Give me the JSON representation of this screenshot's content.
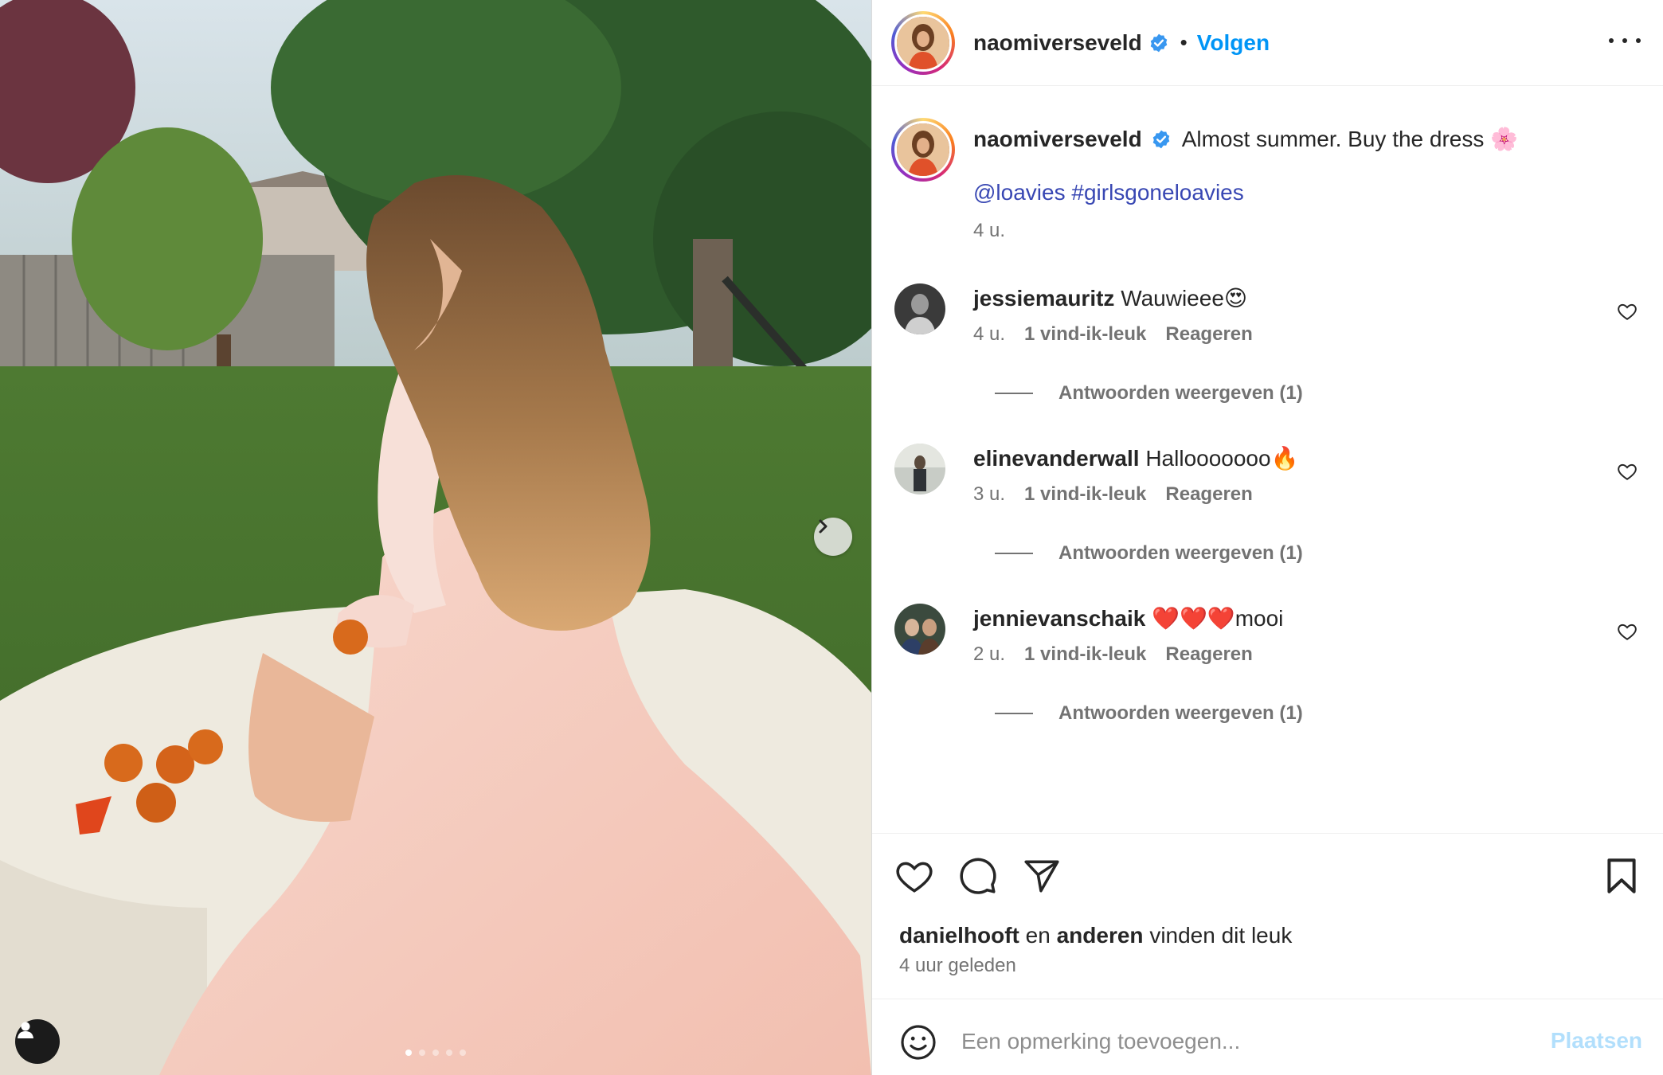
{
  "post": {
    "author": "naomiverseveld",
    "follow_label": "Volgen",
    "bullet": "•",
    "caption_text": "Almost summer. Buy the dress 🌸",
    "caption_mention": "@loavies",
    "caption_hashtag": "#girlsgoneloavies",
    "caption_time": "4 u."
  },
  "comments": [
    {
      "user": "jessiemauritz",
      "text": "Wauwieee😍",
      "time": "4 u.",
      "likes": "1 vind-ik-leuk",
      "reply": "Reageren",
      "view_replies": "Antwoorden weergeven (1)"
    },
    {
      "user": "elinevanderwall",
      "text": "Hallooooooo🔥",
      "time": "3 u.",
      "likes": "1 vind-ik-leuk",
      "reply": "Reageren",
      "view_replies": "Antwoorden weergeven (1)"
    },
    {
      "user": "jennievanschaik",
      "text": "❤️❤️❤️mooi",
      "time": "2 u.",
      "likes": "1 vind-ik-leuk",
      "reply": "Reageren",
      "view_replies": "Antwoorden weergeven (1)"
    }
  ],
  "likes_summary": {
    "first_user": "danielhooft",
    "connector": "en",
    "others": "anderen",
    "suffix": "vinden dit leuk",
    "time_ago": "4 uur geleden"
  },
  "composer": {
    "placeholder": "Een opmerking toevoegen...",
    "post_label": "Plaatsen"
  },
  "carousel": {
    "total_slides": 5,
    "active_index": 0
  },
  "icons": {
    "verified": "verified-badge-icon",
    "more": "more-options-icon",
    "like": "heart-icon",
    "comment": "comment-icon",
    "share": "share-icon",
    "save": "bookmark-icon",
    "emoji": "emoji-icon",
    "next": "chevron-right-icon",
    "tagged": "user-tag-icon"
  },
  "colors": {
    "link_blue": "#0095f6",
    "hashtag": "#3847b3",
    "muted": "#737373",
    "post_disabled": "#b2dffc"
  }
}
